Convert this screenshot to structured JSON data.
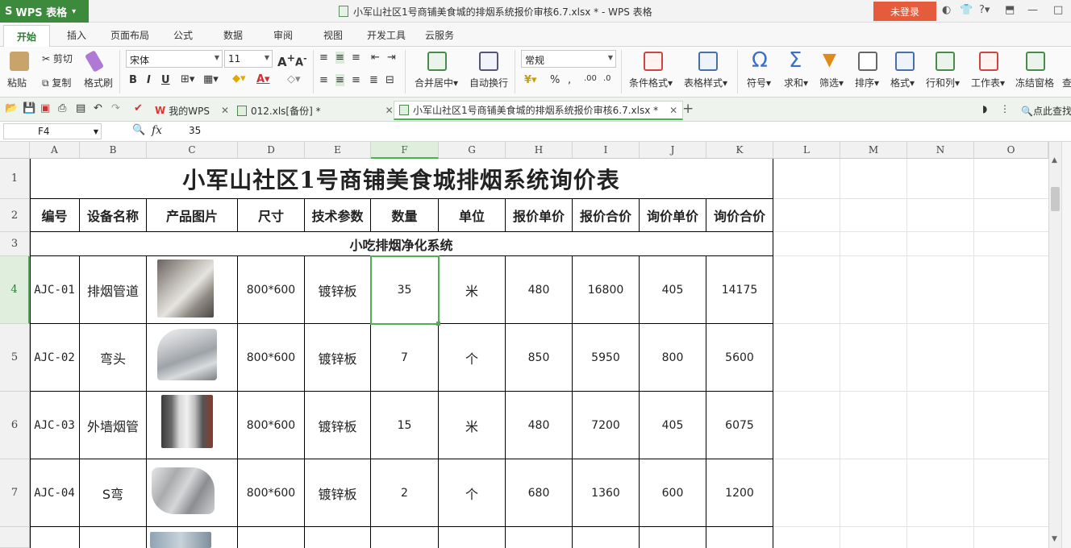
{
  "app": {
    "badge": "WPS 表格",
    "window_title": "小军山社区1号商铺美食城的排烟系统报价审核6.7.xlsx * - WPS 表格",
    "login": "未登录"
  },
  "ribbon_tabs": [
    "开始",
    "插入",
    "页面布局",
    "公式",
    "数据",
    "审阅",
    "视图",
    "开发工具",
    "云服务"
  ],
  "ribbon": {
    "paste": "粘贴",
    "cut": "剪切",
    "copy": "复制",
    "format_painter": "格式刷",
    "font_name": "宋体",
    "font_size": "11",
    "merge_center": "合并居中",
    "wrap_text": "自动换行",
    "number_format": "常规",
    "cond_format": "条件格式",
    "table_style": "表格样式",
    "symbol": "符号",
    "sum": "求和",
    "filter": "筛选",
    "sort": "排序",
    "format": "格式",
    "rowcol": "行和列",
    "sheet": "工作表",
    "freeze": "冻结窗格",
    "find": "查"
  },
  "doc_tabs": {
    "my_wps": "我的WPS",
    "tab2": "012.xls[备份] *",
    "tab3": "小军山社区1号商铺美食城的排烟系统报价审核6.7.xlsx *",
    "search": "点此查找"
  },
  "formula": {
    "cell_ref": "F4",
    "value": "35"
  },
  "columns": [
    "A",
    "B",
    "C",
    "D",
    "E",
    "F",
    "G",
    "H",
    "I",
    "J",
    "K",
    "L",
    "M",
    "N",
    "O"
  ],
  "rows": [
    "1",
    "2",
    "3",
    "4",
    "5",
    "6",
    "7"
  ],
  "sheet": {
    "title": "小军山社区1号商铺美食城排烟系统询价表",
    "headers": [
      "编号",
      "设备名称",
      "产品图片",
      "尺寸",
      "技术参数",
      "数量",
      "单位",
      "报价单价",
      "报价合价",
      "询价单价",
      "询价合价"
    ],
    "section": "小吃排烟净化系统",
    "data_rows": [
      {
        "code": "AJC-01",
        "name": "排烟管道",
        "size": "800*600",
        "spec": "镀锌板",
        "qty": "35",
        "unit": "米",
        "quote_price": "480",
        "quote_total": "16800",
        "inq_price": "405",
        "inq_total": "14175"
      },
      {
        "code": "AJC-02",
        "name": "弯头",
        "size": "800*600",
        "spec": "镀锌板",
        "qty": "7",
        "unit": "个",
        "quote_price": "850",
        "quote_total": "5950",
        "inq_price": "800",
        "inq_total": "5600"
      },
      {
        "code": "AJC-03",
        "name": "外墙烟管",
        "size": "800*600",
        "spec": "镀锌板",
        "qty": "15",
        "unit": "米",
        "quote_price": "480",
        "quote_total": "7200",
        "inq_price": "405",
        "inq_total": "6075"
      },
      {
        "code": "AJC-04",
        "name": "S弯",
        "size": "800*600",
        "spec": "镀锌板",
        "qty": "2",
        "unit": "个",
        "quote_price": "680",
        "quote_total": "1360",
        "inq_price": "600",
        "inq_total": "1200"
      }
    ]
  }
}
